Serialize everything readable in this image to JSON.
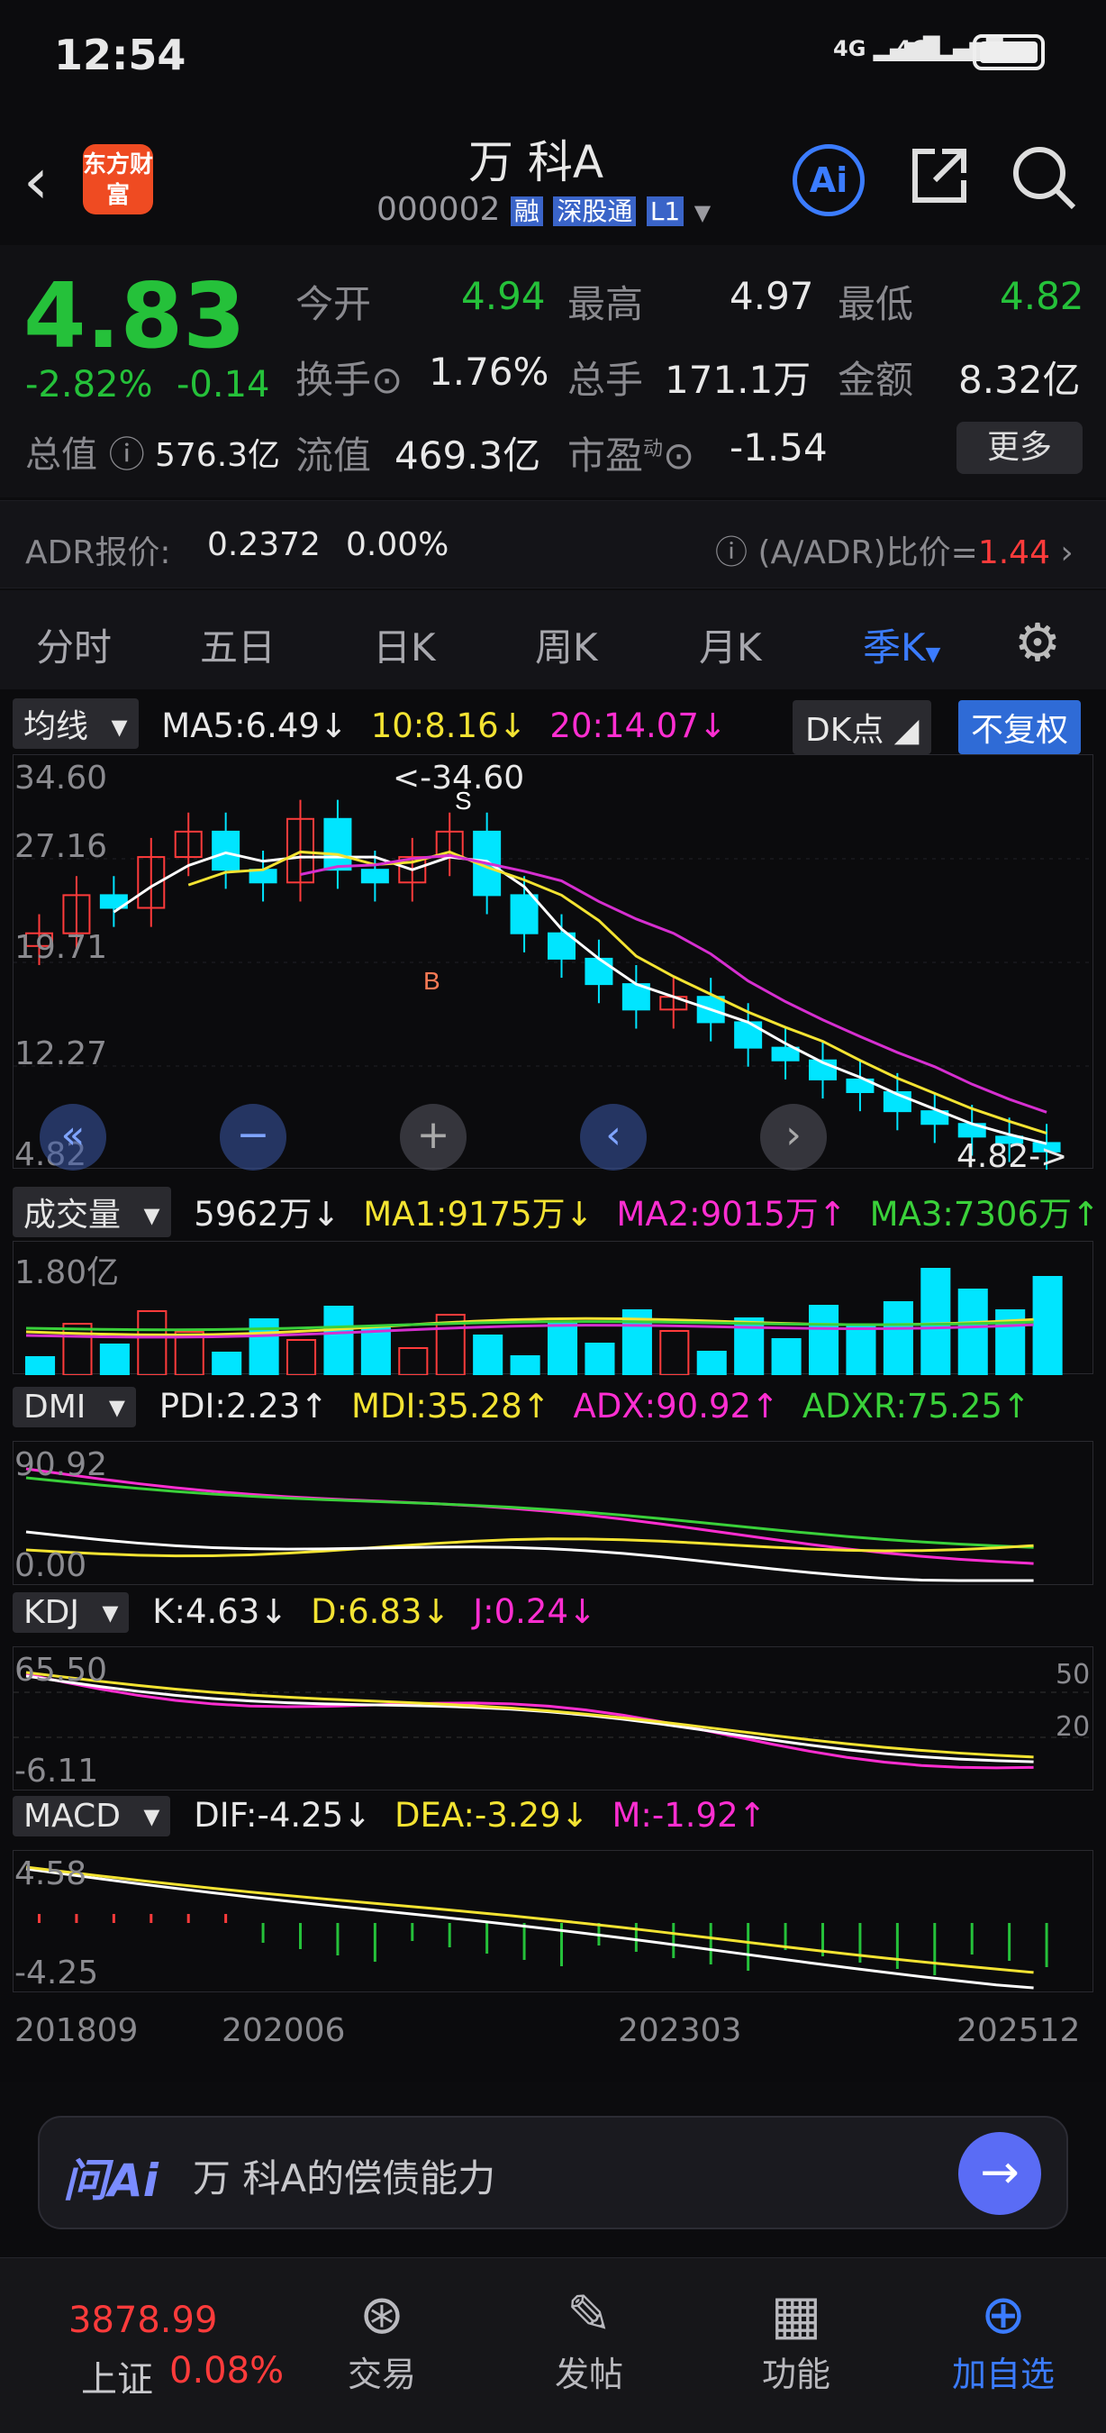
{
  "status_bar": {
    "time": "12:54",
    "signal1": "4G",
    "signal2": "4G"
  },
  "header": {
    "brand_logo_text": "东方财富",
    "title": "万 科A",
    "code": "000002",
    "badge_margin": "融",
    "badge_connect": "深股通",
    "badge_level": "L1"
  },
  "quote": {
    "price": "4.83",
    "change_pct": "-2.82%",
    "change": "-0.14",
    "open_label": "今开",
    "open": "4.94",
    "high_label": "最高",
    "high": "4.97",
    "low_label": "最低",
    "low": "4.82",
    "turnover_label": "换手",
    "turnover": "1.76%",
    "volume_label": "总手",
    "volume": "171.1万",
    "amount_label": "金额",
    "amount": "8.32亿",
    "mktcap_label": "总值",
    "mktcap": "576.3亿",
    "float_label": "流值",
    "float": "469.3亿",
    "pe_label": "市盈",
    "pe_sup": "动",
    "pe": "-1.54",
    "more_button": "更多"
  },
  "adr": {
    "label": "ADR报价:",
    "price": "0.2372",
    "pct": "0.00%",
    "ratio_label": "(A/ADR)比价=",
    "ratio": "1.44"
  },
  "tabs": [
    "分时",
    "五日",
    "日K",
    "周K",
    "月K",
    "季K"
  ],
  "active_tab": "季K",
  "main_chart": {
    "ma_select": "均线",
    "ma5": "MA5:6.49↓",
    "ma10": "10:8.16↓",
    "ma20": "20:14.07↓",
    "dk_button": "DK点",
    "rights_button": "不复权",
    "y_labels": [
      "34.60",
      "27.16",
      "19.71",
      "12.27",
      "4.82"
    ],
    "max_label": "<-34.60",
    "min_label": "4.82->",
    "signal_s": "S",
    "signal_b": "B"
  },
  "volume_panel": {
    "select": "成交量",
    "vol": "5962万↓",
    "ma1": "MA1:9175万↓",
    "ma2": "MA2:9015万↑",
    "ma3": "MA3:7306万↑",
    "y_label": "1.80亿"
  },
  "dmi_panel": {
    "select": "DMI",
    "pdi": "PDI:2.23↑",
    "mdi": "MDI:35.28↑",
    "adx": "ADX:90.92↑",
    "adxr": "ADXR:75.25↑",
    "y_top": "90.92",
    "y_bottom": "0.00"
  },
  "kdj_panel": {
    "select": "KDJ",
    "k": "K:4.63↓",
    "d": "D:6.83↓",
    "j": "J:0.24↓",
    "y_top": "65.50",
    "y_bottom": "-6.11",
    "ref_80": "50",
    "ref_20": "20"
  },
  "macd_panel": {
    "select": "MACD",
    "dif": "DIF:-4.25↓",
    "dea": "DEA:-3.29↓",
    "m": "M:-1.92↑",
    "y_top": "4.58",
    "y_bottom": "-4.25"
  },
  "x_axis": [
    "201809",
    "202006",
    "202303",
    "202512"
  ],
  "ask_ai": {
    "logo": "问Ai",
    "prompt": "万 科A的偿债能力"
  },
  "bottom_nav": {
    "index_value": "3878.99",
    "index_name": "上证",
    "index_pct": "0.08%",
    "trade": "交易",
    "post": "发帖",
    "features": "功能",
    "add_watch": "加自选"
  },
  "colors": {
    "up": "#ff3b3b",
    "down": "#25c13a",
    "candle_down": "#00e5ff",
    "accent": "#3b7cff",
    "ma5": "#ffffff",
    "ma10": "#f3e332",
    "ma20": "#d62fd0"
  },
  "chart_data": {
    "type": "candlestick",
    "period": "quarterly",
    "closes": [
      22,
      25,
      24,
      28,
      30,
      27,
      26,
      31,
      27,
      26,
      28,
      30,
      25,
      22,
      20,
      18,
      16,
      17,
      15,
      13,
      12,
      10.5,
      9.5,
      8,
      7,
      6,
      5.5,
      4.83
    ],
    "ylim": [
      4.82,
      34.6
    ],
    "ma5": 6.49,
    "ma10": 8.16,
    "ma20": 14.07
  }
}
